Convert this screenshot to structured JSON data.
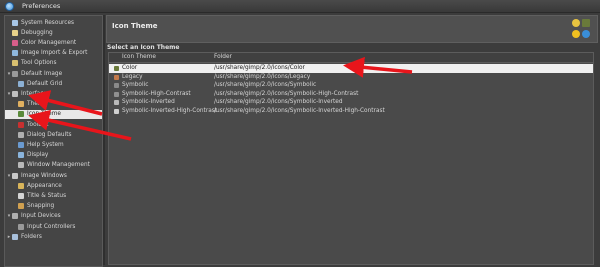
{
  "window": {
    "title": "Preferences"
  },
  "sidebar": {
    "items": [
      {
        "label": "System Resources",
        "expander": "",
        "icon": "system-resources-icon",
        "color": "#a8c7e8",
        "indent": 0
      },
      {
        "label": "Debugging",
        "expander": "",
        "icon": "debugging-icon",
        "color": "#e8d28a",
        "indent": 0
      },
      {
        "label": "Color Management",
        "expander": "",
        "icon": "color-management-icon",
        "color": "#d85e8a",
        "indent": 0
      },
      {
        "label": "Image Import & Export",
        "expander": "",
        "icon": "image-import-export-icon",
        "color": "#8fb8de",
        "indent": 0
      },
      {
        "label": "Tool Options",
        "expander": "",
        "icon": "tool-options-icon",
        "color": "#d8c070",
        "indent": 0
      },
      {
        "label": "Default Image",
        "expander": "▾",
        "icon": "default-image-icon",
        "color": "#9a9a9a",
        "indent": 0
      },
      {
        "label": "Default Grid",
        "expander": "",
        "icon": "default-grid-icon",
        "color": "#8cb0d4",
        "indent": 1
      },
      {
        "label": "Interface",
        "expander": "▾",
        "icon": "interface-icon",
        "color": "#c0c0c0",
        "indent": 0
      },
      {
        "label": "Theme",
        "expander": "",
        "icon": "theme-icon",
        "color": "#e0b060",
        "indent": 1
      },
      {
        "label": "Icon Theme",
        "expander": "",
        "icon": "icon-theme-icon",
        "color": "#5a8a3a",
        "indent": 1
      },
      {
        "label": "Toolbox",
        "expander": "",
        "icon": "toolbox-icon",
        "color": "#c83030",
        "indent": 1
      },
      {
        "label": "Dialog Defaults",
        "expander": "",
        "icon": "dialog-defaults-icon",
        "color": "#b0b0b0",
        "indent": 1
      },
      {
        "label": "Help System",
        "expander": "",
        "icon": "help-system-icon",
        "color": "#6a9ad0",
        "indent": 1
      },
      {
        "label": "Display",
        "expander": "",
        "icon": "display-icon",
        "color": "#8ab4dc",
        "indent": 1
      },
      {
        "label": "Window Management",
        "expander": "",
        "icon": "window-management-icon",
        "color": "#b8b8b8",
        "indent": 1
      },
      {
        "label": "Image Windows",
        "expander": "▾",
        "icon": "image-windows-icon",
        "color": "#c8c8c8",
        "indent": 0
      },
      {
        "label": "Appearance",
        "expander": "",
        "icon": "appearance-icon",
        "color": "#d8b45a",
        "indent": 1
      },
      {
        "label": "Title & Status",
        "expander": "",
        "icon": "title-status-icon",
        "color": "#d4d4d4",
        "indent": 1
      },
      {
        "label": "Snapping",
        "expander": "",
        "icon": "snapping-icon",
        "color": "#d0a050",
        "indent": 1
      },
      {
        "label": "Input Devices",
        "expander": "▾",
        "icon": "input-devices-icon",
        "color": "#b0b0b0",
        "indent": 0
      },
      {
        "label": "Input Controllers",
        "expander": "",
        "icon": "input-controllers-icon",
        "color": "#9a9a9a",
        "indent": 1
      },
      {
        "label": "Folders",
        "expander": "▸",
        "icon": "folders-icon",
        "color": "#a8c0dc",
        "indent": 0
      }
    ],
    "selected_index": 9
  },
  "header": {
    "title": "Icon Theme"
  },
  "section": {
    "label": "Select an Icon Theme"
  },
  "table": {
    "columns": [
      "Icon Theme",
      "Folder"
    ],
    "rows": [
      {
        "name": "Color",
        "folder": "/usr/share/gimp/2.0/icons/Color",
        "icon": "color-theme-icon",
        "color": "#6a7a3a"
      },
      {
        "name": "Legacy",
        "folder": "/usr/share/gimp/2.0/icons/Legacy",
        "icon": "legacy-theme-icon",
        "color": "#c47a4a"
      },
      {
        "name": "Symbolic",
        "folder": "/usr/share/gimp/2.0/icons/Symbolic",
        "icon": "symbolic-theme-icon",
        "color": "#8a8a8a"
      },
      {
        "name": "Symbolic-High-Contrast",
        "folder": "/usr/share/gimp/2.0/icons/Symbolic-High-Contrast",
        "icon": "symbolic-high-contrast-icon",
        "color": "#909090"
      },
      {
        "name": "Symbolic-Inverted",
        "folder": "/usr/share/gimp/2.0/icons/Symbolic-Inverted",
        "icon": "symbolic-inverted-icon",
        "color": "#b8b8b8"
      },
      {
        "name": "Symbolic-Inverted-High-Contrast",
        "folder": "/usr/share/gimp/2.0/icons/Symbolic-Inverted-High-Contrast",
        "icon": "symbolic-inverted-high-contrast-icon",
        "color": "#d0d0d0"
      }
    ],
    "selected_index": 0
  },
  "annotations": {
    "arrow_color": "#e8151b"
  }
}
